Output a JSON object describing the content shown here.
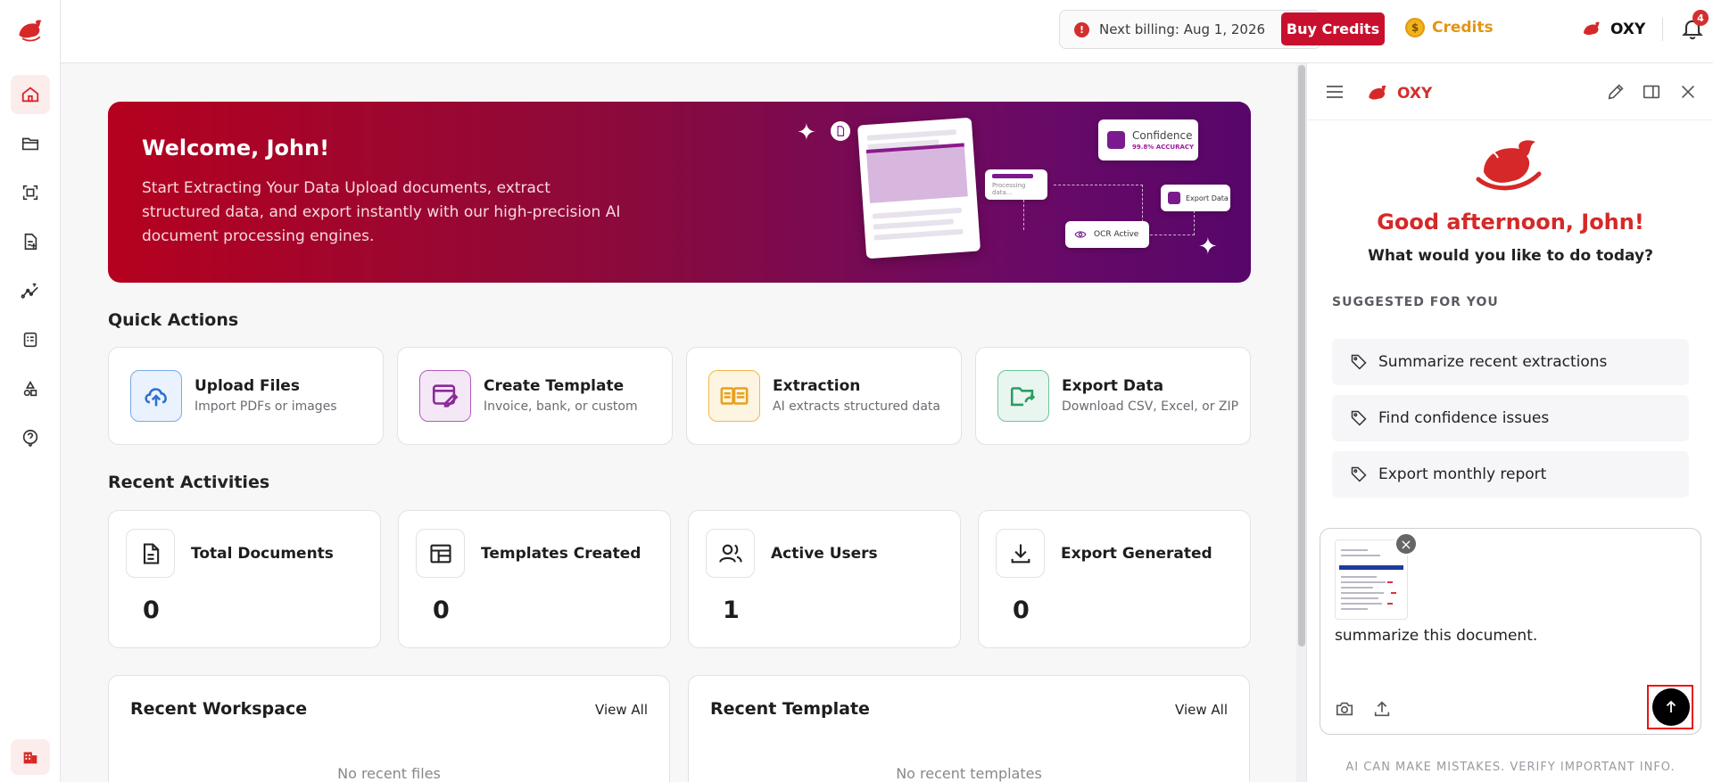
{
  "topbar": {
    "billing_label": "Next billing: Aug 1, 2026",
    "billing_icon_glyph": "!",
    "buy_label": "Buy Credits",
    "credits_label": "Credits",
    "coin_glyph": "$",
    "brand": "OXY",
    "notification_count": "4"
  },
  "banner": {
    "title": "Welcome, John!",
    "text": "Start Extracting Your Data Upload documents, extract structured data, and export instantly with our high-precision AI document processing engines.",
    "chip_confidence": "Confidence",
    "chip_accuracy": "99.8% ACCURACY",
    "chip_processing": "Processing data...",
    "chip_ocr": "OCR Active",
    "chip_export": "Export Data"
  },
  "quick_actions": {
    "title": "Quick Actions",
    "items": [
      {
        "title": "Upload Files",
        "subtitle": "Import PDFs or images"
      },
      {
        "title": "Create Template",
        "subtitle": "Invoice, bank, or custom"
      },
      {
        "title": "Extraction",
        "subtitle": "AI extracts structured data"
      },
      {
        "title": "Export Data",
        "subtitle": "Download CSV, Excel, or ZIP"
      }
    ]
  },
  "recent_activities": {
    "title": "Recent Activities",
    "items": [
      {
        "title": "Total Documents",
        "value": "0"
      },
      {
        "title": "Templates Created",
        "value": "0"
      },
      {
        "title": "Active Users",
        "value": "1"
      },
      {
        "title": "Export Generated",
        "value": "0"
      }
    ]
  },
  "recent_workspace": {
    "title": "Recent Workspace",
    "view_all": "View All",
    "empty": "No recent files"
  },
  "recent_template": {
    "title": "Recent Template",
    "view_all": "View All",
    "empty": "No recent templates"
  },
  "panel": {
    "brand": "OXY",
    "greeting": "Good afternoon, John!",
    "question": "What would you like to do today?",
    "suggested_heading": "SUGGESTED FOR YOU",
    "suggestions": [
      "Summarize recent extractions",
      "Find confidence issues",
      "Export monthly report"
    ],
    "composer_text": "summarize this document.",
    "attachment_remove_glyph": "×",
    "disclaimer": "AI CAN MAKE MISTAKES. VERIFY IMPORTANT INFO."
  },
  "colors": {
    "brand_red": "#c8102e",
    "banner_start": "#b5011f",
    "banner_end": "#57066a",
    "credits": "#e59512"
  }
}
